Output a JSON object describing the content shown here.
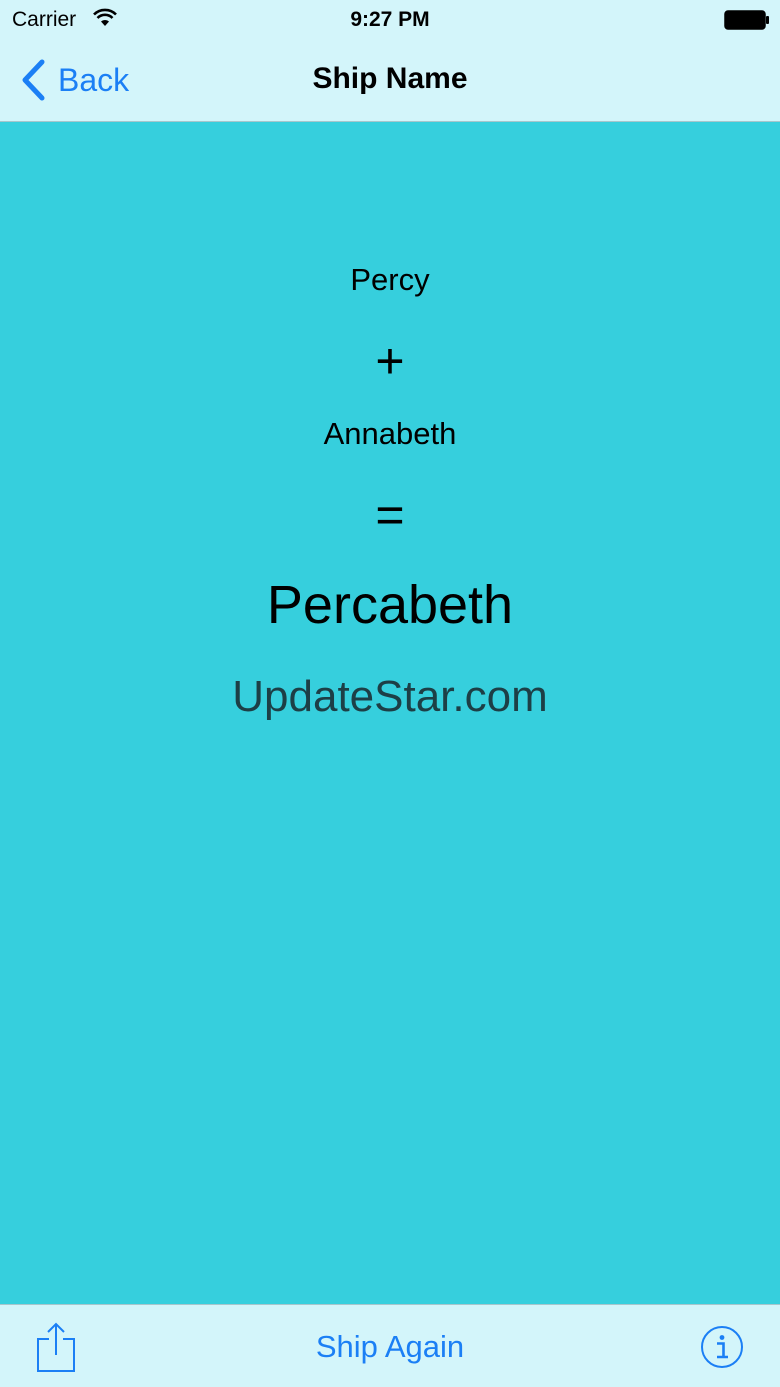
{
  "status_bar": {
    "carrier": "Carrier",
    "time": "9:27 PM",
    "wifi_icon": "wifi-icon",
    "battery_icon": "battery-icon"
  },
  "nav_bar": {
    "back_label": "Back",
    "title": "Ship Name"
  },
  "content": {
    "first_name": "Percy",
    "plus": "+",
    "second_name": "Annabeth",
    "equals": "=",
    "ship_name": "Percabeth",
    "watermark": "UpdateStar.com"
  },
  "toolbar": {
    "share_icon": "share-icon",
    "ship_again_label": "Ship Again",
    "info_icon": "info-icon"
  },
  "colors": {
    "accent": "#1b7ff5",
    "background": "#36cfdd",
    "bar_background": "#d3f5fa"
  }
}
